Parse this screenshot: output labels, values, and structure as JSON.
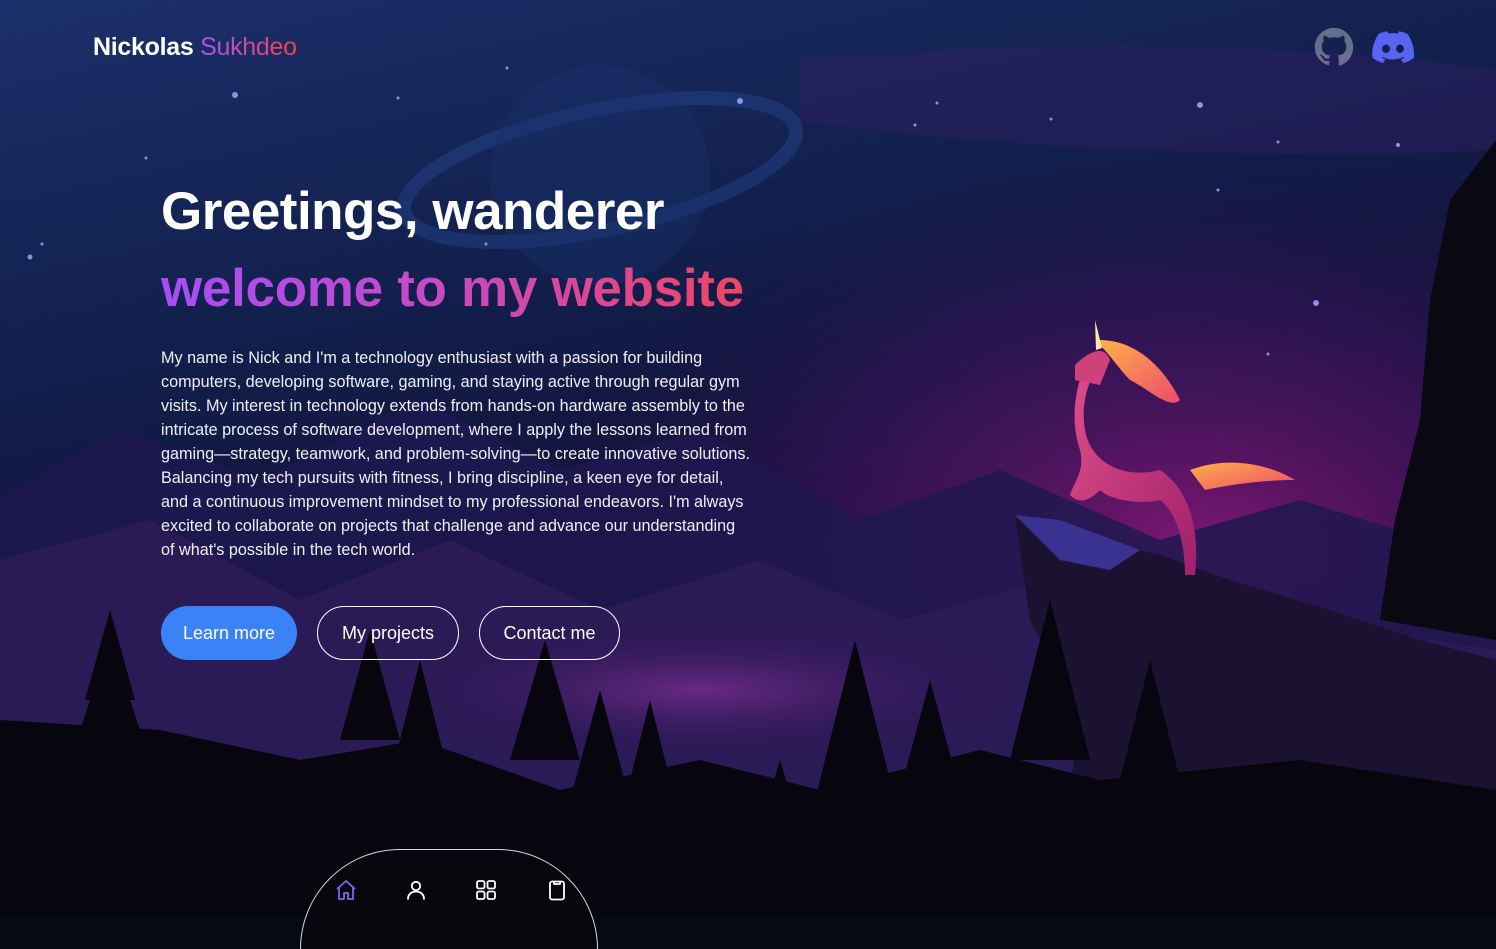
{
  "header": {
    "brand_first": "Nickolas",
    "brand_last": "Sukhdeo",
    "social": [
      {
        "name": "github",
        "icon": "github-icon"
      },
      {
        "name": "discord",
        "icon": "discord-icon"
      }
    ]
  },
  "hero": {
    "headline": "Greetings, wanderer",
    "subheadline": "welcome to my website",
    "intro": "My name is Nick and I'm a technology enthusiast with a passion for building computers, developing software, gaming, and staying active through regular gym visits. My interest in technology extends from hands-on hardware assembly to the intricate process of software development, where I apply the lessons learned from gaming—strategy, teamwork, and problem-solving—to create innovative solutions. Balancing my tech pursuits with fitness, I bring discipline, a keen eye for detail, and a continuous improvement mindset to my professional endeavors. I'm always excited to collaborate on projects that challenge and advance our understanding of what's possible in the tech world.",
    "buttons": {
      "learn_more": "Learn more",
      "projects": "My projects",
      "contact": "Contact me"
    }
  },
  "dock": {
    "items": [
      {
        "icon": "home-icon",
        "active": true
      },
      {
        "icon": "user-icon",
        "active": false
      },
      {
        "icon": "grid-icon",
        "active": false
      },
      {
        "icon": "clipboard-icon",
        "active": false
      }
    ]
  },
  "colors": {
    "accent_blue": "#3b82f6",
    "gradient_start": "#a855f7",
    "gradient_end": "#ef4444",
    "active_icon": "#8b5cf6",
    "discord": "#5865f2"
  }
}
